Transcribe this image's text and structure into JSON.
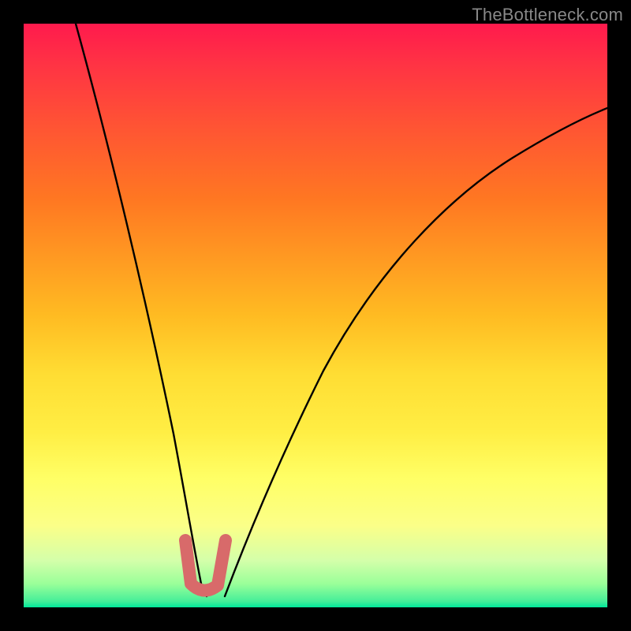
{
  "attribution": "TheBottleneck.com",
  "chart_data": {
    "type": "line",
    "title": "",
    "xlabel": "",
    "ylabel": "",
    "xlim": [
      0,
      100
    ],
    "ylim": [
      0,
      100
    ],
    "legend": false,
    "grid": false,
    "background_gradient": {
      "orientation": "vertical",
      "stops": [
        {
          "pos": 0,
          "color": "#ff1a4d"
        },
        {
          "pos": 50,
          "color": "#ffdd33"
        },
        {
          "pos": 80,
          "color": "#ffff66"
        },
        {
          "pos": 100,
          "color": "#00e99a"
        }
      ]
    },
    "series": [
      {
        "name": "bottleneck-curve-left",
        "x": [
          9,
          12,
          15,
          18,
          21,
          23,
          25,
          27,
          28,
          29,
          30
        ],
        "y": [
          100,
          85,
          70,
          55,
          40,
          28,
          18,
          10,
          5,
          2,
          0
        ]
      },
      {
        "name": "bottleneck-curve-right",
        "x": [
          33,
          35,
          38,
          42,
          48,
          55,
          63,
          72,
          82,
          92,
          100
        ],
        "y": [
          0,
          4,
          10,
          20,
          32,
          44,
          54,
          62,
          70,
          76,
          81
        ]
      }
    ],
    "markers": [
      {
        "name": "optimal-range",
        "shape": "u",
        "points": [
          {
            "x": 27.5,
            "y": 11
          },
          {
            "x": 28.5,
            "y": 3
          },
          {
            "x": 31,
            "y": 2
          },
          {
            "x": 33,
            "y": 3
          },
          {
            "x": 34.5,
            "y": 11
          }
        ],
        "color": "#d86a6a"
      }
    ]
  }
}
